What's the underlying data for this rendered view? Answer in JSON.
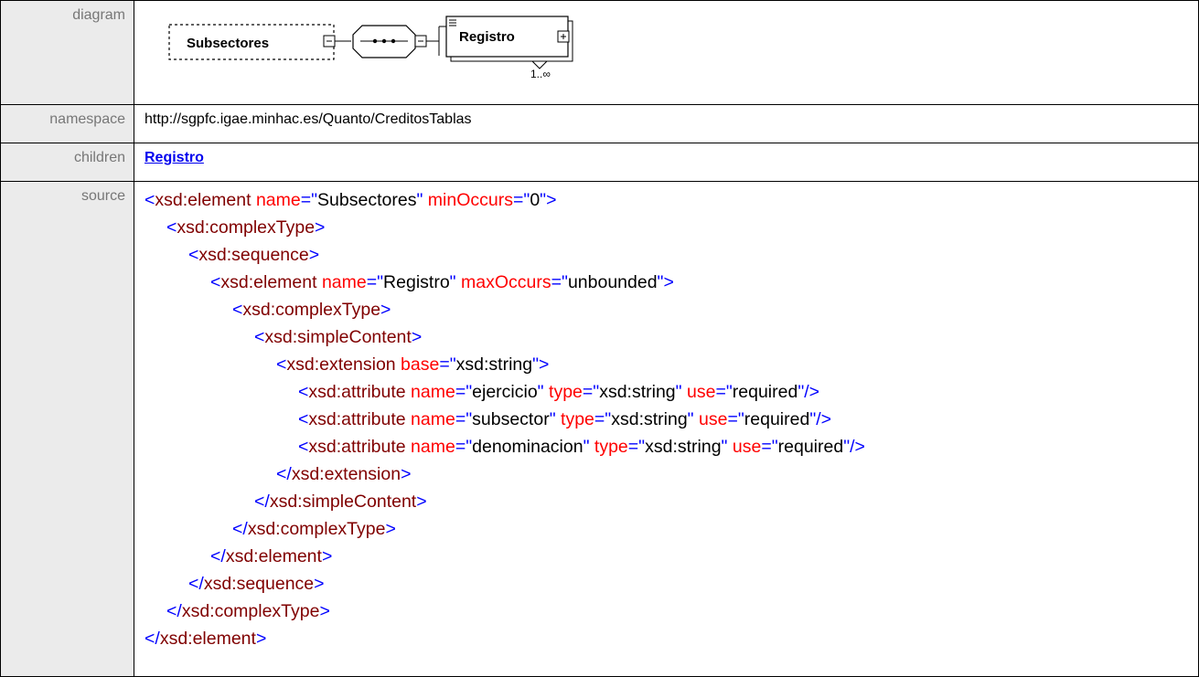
{
  "rows": {
    "diagram_label": "diagram",
    "namespace_label": "namespace",
    "children_label": "children",
    "source_label": "source"
  },
  "diagram": {
    "element_name": "Subsectores",
    "child_name": "Registro",
    "cardinality": "1..∞",
    "colors": {
      "box_fill": "#ffffff",
      "stroke": "#000000",
      "dashed": "#000000"
    }
  },
  "namespace": "http://sgpfc.igae.minhac.es/Quanto/CreditosTablas",
  "children": [
    "Registro"
  ],
  "colors": {
    "bracket": "#0000ff",
    "element": "#800000",
    "attribute": "#ff0000",
    "value": "#000000",
    "label_bg": "#ebebeb",
    "label_text": "#777777"
  },
  "source": [
    {
      "indent": 0,
      "tokens": [
        [
          "b",
          "<"
        ],
        [
          "e",
          "xsd:element"
        ],
        [
          "a",
          " name"
        ],
        [
          "b",
          "=\""
        ],
        [
          "v",
          "Subsectores"
        ],
        [
          "b",
          "\""
        ],
        [
          "a",
          " minOccurs"
        ],
        [
          "b",
          "=\""
        ],
        [
          "v",
          "0"
        ],
        [
          "b",
          "\">"
        ]
      ]
    },
    {
      "indent": 1,
      "tokens": [
        [
          "b",
          "<"
        ],
        [
          "e",
          "xsd:complexType"
        ],
        [
          "b",
          ">"
        ]
      ]
    },
    {
      "indent": 2,
      "tokens": [
        [
          "b",
          "<"
        ],
        [
          "e",
          "xsd:sequence"
        ],
        [
          "b",
          ">"
        ]
      ]
    },
    {
      "indent": 3,
      "tokens": [
        [
          "b",
          "<"
        ],
        [
          "e",
          "xsd:element"
        ],
        [
          "a",
          " name"
        ],
        [
          "b",
          "=\""
        ],
        [
          "v",
          "Registro"
        ],
        [
          "b",
          "\""
        ],
        [
          "a",
          " maxOccurs"
        ],
        [
          "b",
          "=\""
        ],
        [
          "v",
          "unbounded"
        ],
        [
          "b",
          "\">"
        ]
      ]
    },
    {
      "indent": 4,
      "tokens": [
        [
          "b",
          "<"
        ],
        [
          "e",
          "xsd:complexType"
        ],
        [
          "b",
          ">"
        ]
      ]
    },
    {
      "indent": 5,
      "tokens": [
        [
          "b",
          "<"
        ],
        [
          "e",
          "xsd:simpleContent"
        ],
        [
          "b",
          ">"
        ]
      ]
    },
    {
      "indent": 6,
      "tokens": [
        [
          "b",
          "<"
        ],
        [
          "e",
          "xsd:extension"
        ],
        [
          "a",
          " base"
        ],
        [
          "b",
          "=\""
        ],
        [
          "v",
          "xsd:string"
        ],
        [
          "b",
          "\">"
        ]
      ]
    },
    {
      "indent": 7,
      "tokens": [
        [
          "b",
          "<"
        ],
        [
          "e",
          "xsd:attribute"
        ],
        [
          "a",
          " name"
        ],
        [
          "b",
          "=\""
        ],
        [
          "v",
          "ejercicio"
        ],
        [
          "b",
          "\""
        ],
        [
          "a",
          " type"
        ],
        [
          "b",
          "=\""
        ],
        [
          "v",
          "xsd:string"
        ],
        [
          "b",
          "\""
        ],
        [
          "a",
          " use"
        ],
        [
          "b",
          "=\""
        ],
        [
          "v",
          "required"
        ],
        [
          "b",
          "\"/>"
        ]
      ]
    },
    {
      "indent": 7,
      "tokens": [
        [
          "b",
          "<"
        ],
        [
          "e",
          "xsd:attribute"
        ],
        [
          "a",
          " name"
        ],
        [
          "b",
          "=\""
        ],
        [
          "v",
          "subsector"
        ],
        [
          "b",
          "\""
        ],
        [
          "a",
          " type"
        ],
        [
          "b",
          "=\""
        ],
        [
          "v",
          "xsd:string"
        ],
        [
          "b",
          "\""
        ],
        [
          "a",
          " use"
        ],
        [
          "b",
          "=\""
        ],
        [
          "v",
          "required"
        ],
        [
          "b",
          "\"/>"
        ]
      ]
    },
    {
      "indent": 7,
      "tokens": [
        [
          "b",
          "<"
        ],
        [
          "e",
          "xsd:attribute"
        ],
        [
          "a",
          " name"
        ],
        [
          "b",
          "=\""
        ],
        [
          "v",
          "denominacion"
        ],
        [
          "b",
          "\""
        ],
        [
          "a",
          " type"
        ],
        [
          "b",
          "=\""
        ],
        [
          "v",
          "xsd:string"
        ],
        [
          "b",
          "\""
        ],
        [
          "a",
          " use"
        ],
        [
          "b",
          "=\""
        ],
        [
          "v",
          "required"
        ],
        [
          "b",
          "\"/>"
        ]
      ]
    },
    {
      "indent": 6,
      "tokens": [
        [
          "b",
          "</"
        ],
        [
          "e",
          "xsd:extension"
        ],
        [
          "b",
          ">"
        ]
      ]
    },
    {
      "indent": 5,
      "tokens": [
        [
          "b",
          "</"
        ],
        [
          "e",
          "xsd:simpleContent"
        ],
        [
          "b",
          ">"
        ]
      ]
    },
    {
      "indent": 4,
      "tokens": [
        [
          "b",
          "</"
        ],
        [
          "e",
          "xsd:complexType"
        ],
        [
          "b",
          ">"
        ]
      ]
    },
    {
      "indent": 3,
      "tokens": [
        [
          "b",
          "</"
        ],
        [
          "e",
          "xsd:element"
        ],
        [
          "b",
          ">"
        ]
      ]
    },
    {
      "indent": 2,
      "tokens": [
        [
          "b",
          "</"
        ],
        [
          "e",
          "xsd:sequence"
        ],
        [
          "b",
          ">"
        ]
      ]
    },
    {
      "indent": 1,
      "tokens": [
        [
          "b",
          "</"
        ],
        [
          "e",
          "xsd:complexType"
        ],
        [
          "b",
          ">"
        ]
      ]
    },
    {
      "indent": 0,
      "tokens": [
        [
          "b",
          "</"
        ],
        [
          "e",
          "xsd:element"
        ],
        [
          "b",
          ">"
        ]
      ]
    }
  ]
}
